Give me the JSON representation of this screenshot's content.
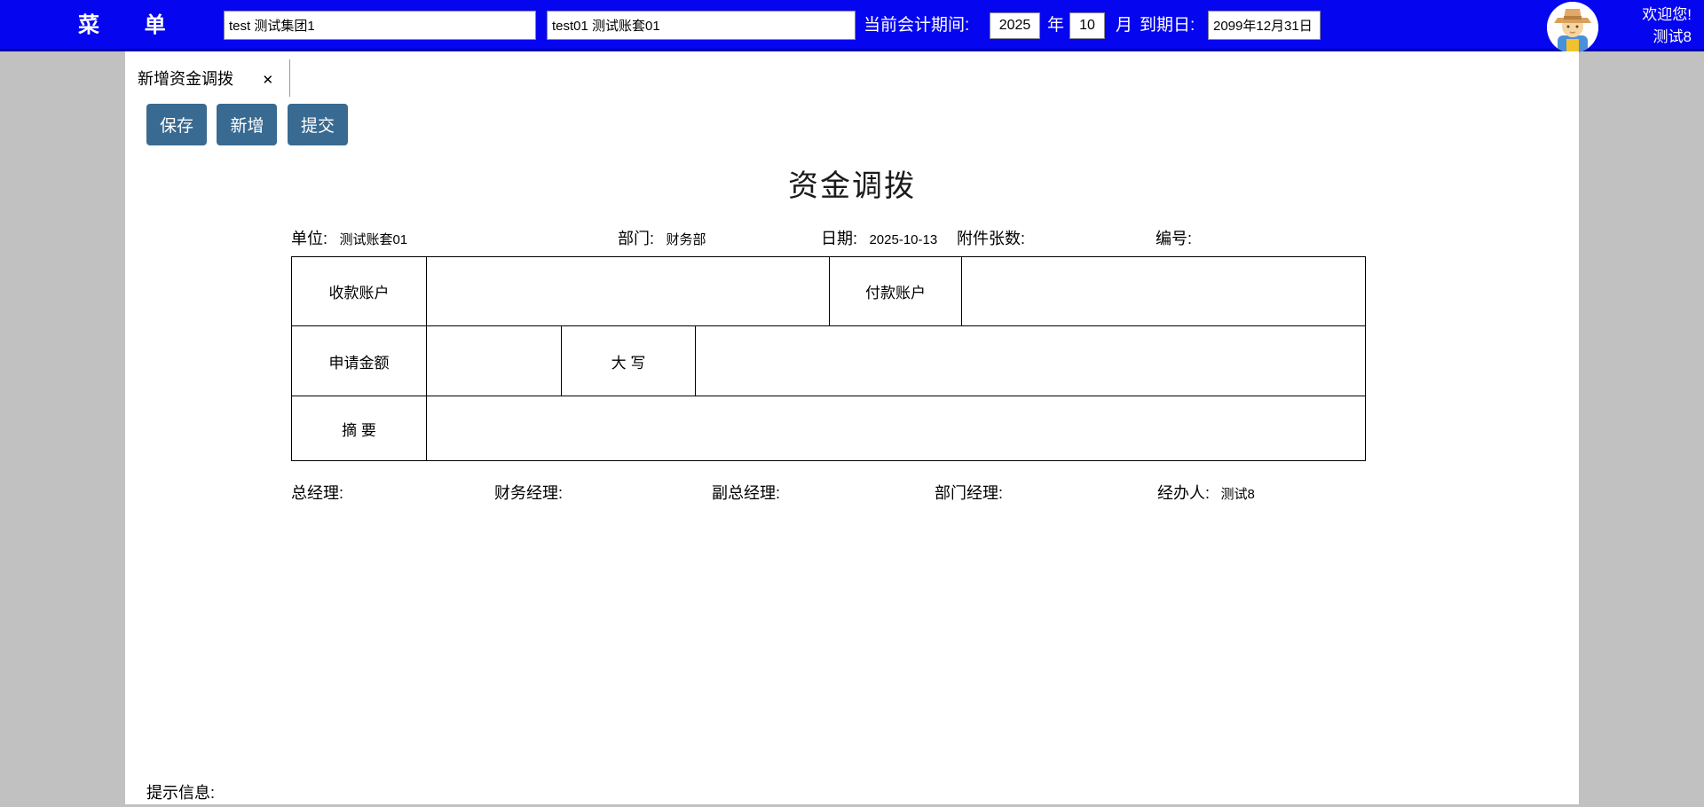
{
  "header": {
    "menu_label": "菜 单",
    "group_input": "test 测试集团1",
    "account_input": "test01 测试账套01",
    "period_label": "当前会计期间:",
    "year_value": "2025",
    "year_unit": "年",
    "month_value": "10",
    "month_unit": "月",
    "expiry_label": "到期日:",
    "expiry_value": "2099年12月31日",
    "welcome_line1": "欢迎您!",
    "welcome_line2": "测试8"
  },
  "tab": {
    "title": "新增资金调拨",
    "close_glyph": "✕"
  },
  "toolbar": {
    "save_label": "保存",
    "add_label": "新增",
    "submit_label": "提交"
  },
  "form": {
    "title": "资金调拨",
    "info": {
      "unit_label": "单位:",
      "unit_value": "测试账套01",
      "dept_label": "部门:",
      "dept_value": "财务部",
      "date_label": "日期:",
      "date_value": "2025-10-13",
      "attach_label": "附件张数:",
      "attach_value": "",
      "no_label": "编号:",
      "no_value": ""
    },
    "table": {
      "receive_account_label": "收款账户",
      "receive_account_value": "",
      "pay_account_label": "付款账户",
      "pay_account_value": "",
      "amount_label": "申请金额",
      "amount_value": "",
      "caps_label": "大  写",
      "caps_value": "",
      "summary_label": "摘  要",
      "summary_value": ""
    },
    "signatures": {
      "gm_label": "总经理:",
      "fm_label": "财务经理:",
      "dgm_label": "副总经理:",
      "dm_label": "部门经理:",
      "handler_label": "经办人:",
      "handler_value": "测试8"
    }
  },
  "footer": {
    "hint_label": "提示信息:"
  },
  "colors": {
    "header_blue": "#0505f0",
    "header_border": "#0000a0",
    "button_blue": "#396a91",
    "page_gray": "#c1c1c1"
  }
}
